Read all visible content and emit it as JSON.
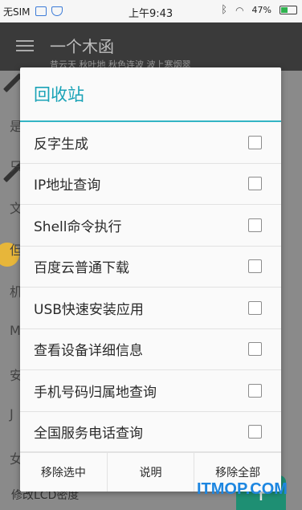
{
  "status_bar": {
    "carrier": "无SIM",
    "time": "上午9:43",
    "battery": "47%",
    "battery_level": 0.47,
    "icons": [
      "image-icon",
      "shield-icon",
      "bluetooth-icon",
      "wifi-icon",
      "battery-icon"
    ]
  },
  "app_bar": {
    "title": "一个木函",
    "subtitle": "昔云天 秋叶地 秋色连波 波上寒烟翠"
  },
  "background": {
    "letters": [
      "是",
      "只",
      "文",
      "但",
      "机",
      "M",
      "安",
      "J",
      "女"
    ],
    "bottom_item": "修改LCD密度",
    "fab_label": "+"
  },
  "dialog": {
    "title": "回收站",
    "items": [
      {
        "label": "反字生成",
        "checked": false
      },
      {
        "label": "IP地址查询",
        "checked": false
      },
      {
        "label": "Shell命令执行",
        "checked": false
      },
      {
        "label": "百度云普通下载",
        "checked": false
      },
      {
        "label": "USB快速安装应用",
        "checked": false
      },
      {
        "label": "查看设备详细信息",
        "checked": false
      },
      {
        "label": "手机号码归属地查询",
        "checked": false
      },
      {
        "label": "全国服务电话查询",
        "checked": false
      }
    ],
    "actions": {
      "remove_selected": "移除选中",
      "help": "说明",
      "remove_all": "移除全部"
    }
  },
  "watermark": "ITMOP.COM",
  "colors": {
    "accent": "#1aa3b7",
    "app_bar": "#3a3a3a",
    "fab": "#1e8f73",
    "watermark": "#1d86e0"
  }
}
